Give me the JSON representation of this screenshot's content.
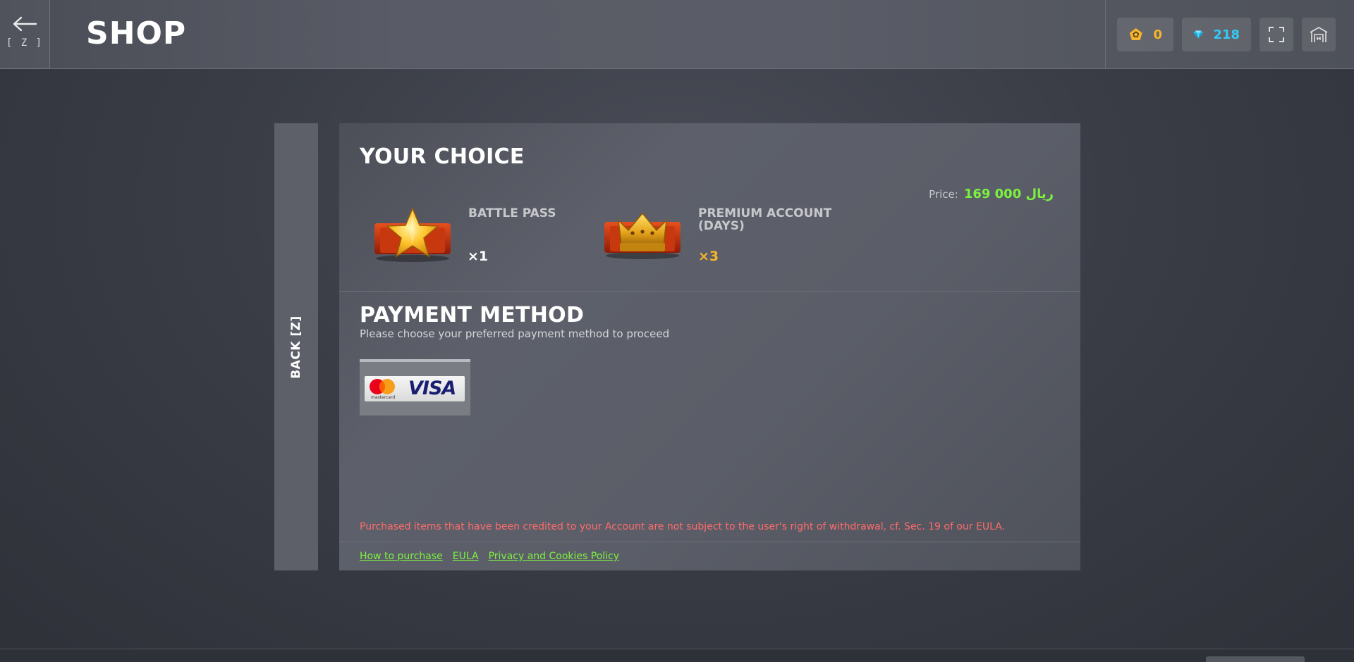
{
  "header": {
    "back_key": "[ Z ]",
    "title": "SHOP",
    "gold_amount": "0",
    "gems_amount": "218",
    "icons": {
      "gold": "gold-pentagon-icon",
      "gems": "diamond-icon",
      "fullscreen": "fullscreen-icon",
      "hangar": "hangar-icon"
    }
  },
  "side_back": {
    "label": "BACK [Z]"
  },
  "choice": {
    "title": "YOUR CHOICE",
    "price_label": "Price:",
    "price_value": "169 000 ریال",
    "items": [
      {
        "name": "BATTLE PASS",
        "qty": "×1",
        "qty_color": "#ffffff",
        "icon": "battle-pass-star-icon"
      },
      {
        "name": "PREMIUM ACCOUNT (DAYS)",
        "qty": "×3",
        "qty_color": "#f6b52a",
        "icon": "premium-crown-icon"
      }
    ]
  },
  "payment": {
    "title": "PAYMENT METHOD",
    "subtitle": "Please choose your preferred payment method to proceed",
    "methods": [
      {
        "id": "mastercard-visa",
        "mastercard_caption": "mastercard",
        "visa_text": "VISA"
      }
    ]
  },
  "disclaimer": "Purchased items that have been credited to your Account are not subject to the user's right of withdrawal, cf. Sec. 19 of our EULA.",
  "footer_links": [
    "How to purchase",
    "EULA",
    "Privacy and Cookies Policy"
  ],
  "colors": {
    "accent_green": "#7cf23f",
    "gold": "#f6b52a",
    "gem_blue": "#35c8f2",
    "warning_red": "#ff6b6b"
  }
}
